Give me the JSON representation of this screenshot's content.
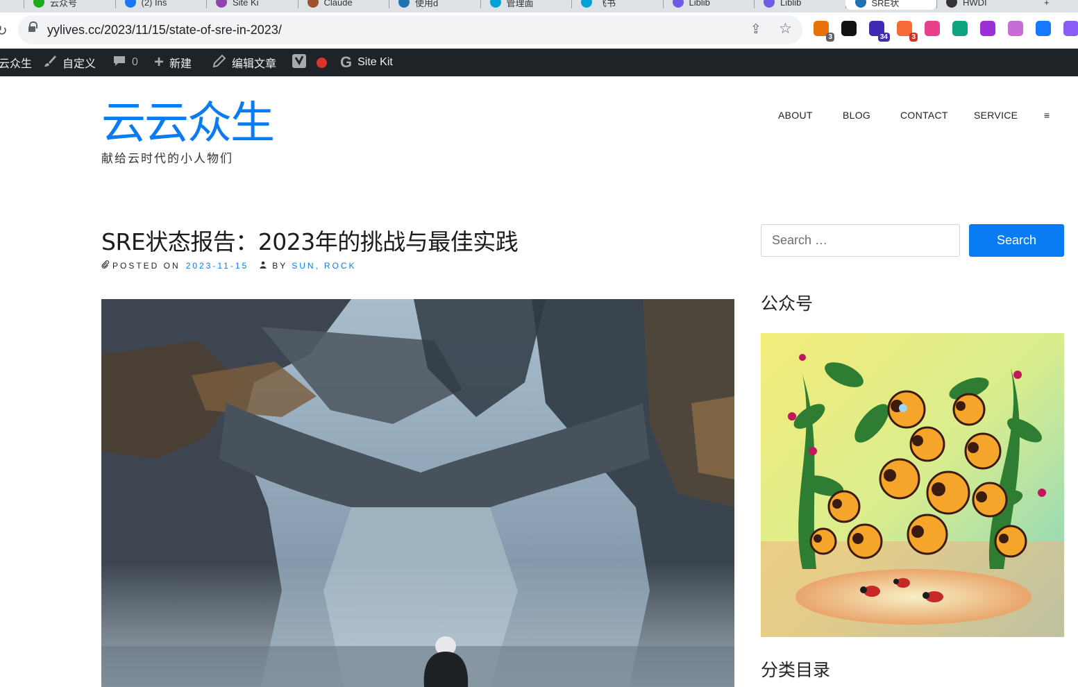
{
  "browser": {
    "tabs": [
      {
        "label": "云众号",
        "color": "#1aad19"
      },
      {
        "label": "(2) Ins",
        "color": "#1877f2"
      },
      {
        "label": "Site Ki",
        "color": "#8e44ad"
      },
      {
        "label": "Claude",
        "color": "#a0522d"
      },
      {
        "label": "使用d",
        "color": "#2271b1"
      },
      {
        "label": "管理面",
        "color": "#00a1d6"
      },
      {
        "label": "飞书",
        "color": "#00a1d6"
      },
      {
        "label": "Liblib",
        "color": "#6c5ce7"
      },
      {
        "label": "Liblib",
        "color": "#6c5ce7"
      },
      {
        "label": "SRE状",
        "color": "#2271b1"
      },
      {
        "label": "HWDI",
        "color": "#333333"
      }
    ],
    "url": "yylives.cc/2023/11/15/state-of-sre-in-2023/",
    "extensions": [
      {
        "name": "chrome-ext-icon",
        "badge": "3",
        "color": "#e8710a",
        "badgeColor": "#5f6368"
      },
      {
        "name": "notion-icon",
        "badge": "",
        "color": "#111111",
        "badgeColor": ""
      },
      {
        "name": "graduation-cap-icon",
        "badge": "34",
        "color": "#3f2bb5",
        "badgeColor": "#3f2bb5"
      },
      {
        "name": "ext-orange-icon",
        "badge": "3",
        "color": "#f76a37",
        "badgeColor": "#d93025"
      },
      {
        "name": "ext-pink-icon",
        "badge": "",
        "color": "#e83e8c",
        "badgeColor": ""
      },
      {
        "name": "ext-teal-icon",
        "badge": "",
        "color": "#10a37f",
        "badgeColor": ""
      },
      {
        "name": "ext-purple-icon",
        "badge": "",
        "color": "#9b30d9",
        "badgeColor": ""
      },
      {
        "name": "ext-cat-icon",
        "badge": "",
        "color": "#c86dd7",
        "badgeColor": ""
      },
      {
        "name": "ext-blue-icon",
        "badge": "",
        "color": "#1677ff",
        "badgeColor": ""
      },
      {
        "name": "openai-icon",
        "badge": "",
        "color": "#8b5cf6",
        "badgeColor": ""
      }
    ]
  },
  "adminbar": {
    "site": "云众生",
    "customize": "自定义",
    "comments": "0",
    "new": "新建",
    "edit": "编辑文章",
    "sitekit": "Site Kit"
  },
  "site": {
    "title": "云云众生",
    "description": "献给云时代的小人物们",
    "accent": "#0a7cf3"
  },
  "nav": {
    "items": [
      "ABOUT",
      "BLOG",
      "CONTACT",
      "SERVICE"
    ],
    "menu": "≡"
  },
  "post": {
    "title": "SRE状态报告：2023年的挑战与最佳实践",
    "posted_on_label": "POSTED ON",
    "date": "2023-11-15",
    "by_label": "BY",
    "author1": "SUN",
    "author2": "ROCK"
  },
  "sidebar": {
    "search_placeholder": "Search …",
    "search_button": "Search",
    "widget1_title": "公众号",
    "widget2_title": "分类目录"
  }
}
